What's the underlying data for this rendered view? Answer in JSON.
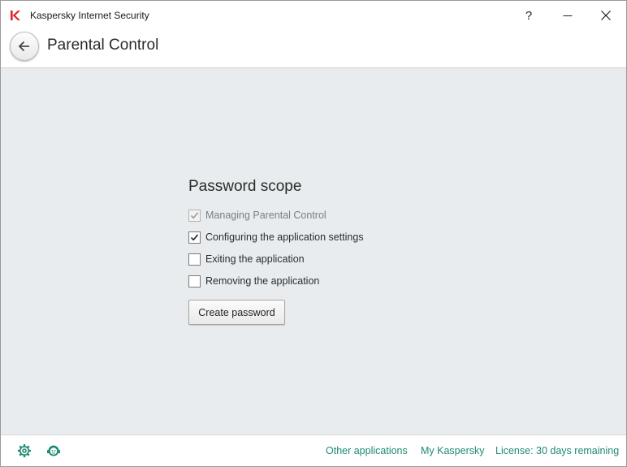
{
  "window": {
    "title": "Kaspersky Internet Security",
    "help_label": "?",
    "logo_icon": "kaspersky-k-logo",
    "minimize_icon": "minimize-icon",
    "close_icon": "close-icon"
  },
  "header": {
    "back_icon": "arrow-left-icon",
    "title": "Parental Control"
  },
  "main": {
    "section_title": "Password scope",
    "options": [
      {
        "label": "Managing Parental Control",
        "checked": true,
        "disabled": true
      },
      {
        "label": "Configuring the application settings",
        "checked": true,
        "disabled": false
      },
      {
        "label": "Exiting the application",
        "checked": false,
        "disabled": false
      },
      {
        "label": "Removing the application",
        "checked": false,
        "disabled": false
      }
    ],
    "create_button": "Create password"
  },
  "footer": {
    "settings_icon": "gear-icon",
    "support_icon": "support-agent-icon",
    "links": [
      "Other applications",
      "My Kaspersky",
      "License: 30 days remaining"
    ]
  },
  "colors": {
    "accent": "#1f8a73",
    "logo_red": "#e0202a",
    "content_bg": "#e8ecef"
  }
}
